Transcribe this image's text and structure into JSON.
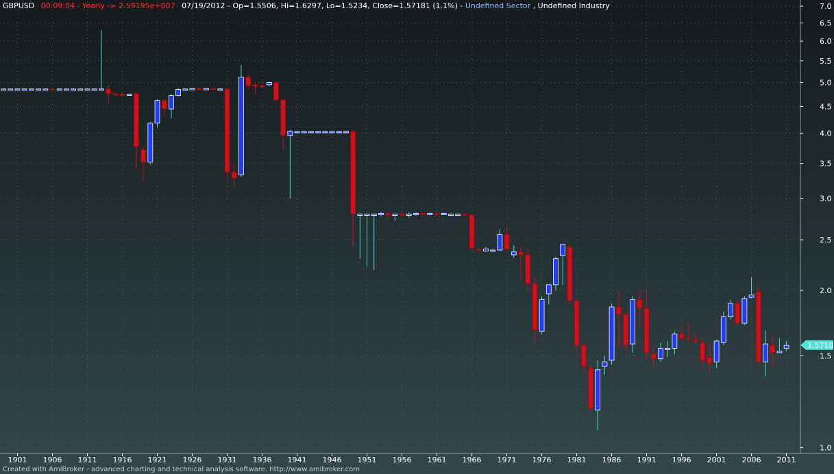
{
  "header": {
    "symbol": "GBPUSD",
    "time_info": "00:09:04 - Yearly -> 2.59195e+007",
    "ohlc": "07/19/2012 - Op=1.5506, Hi=1.6297, Lo=1.5234, Close=1.57181 (1.1%)",
    "separator": " - ",
    "sector": "Undefined Sector",
    "industry": "Undefined Industry"
  },
  "footer": {
    "text": "Created with AmiBroker - advanced charting and technical analysis software. http://www.amibroker.com"
  },
  "colors": {
    "up": "#1f3cff",
    "down": "#d0101a",
    "wick_up": "#4fd8d8",
    "wick_down": "#d0101a",
    "price_badge": "#56e0dc",
    "header_red": "#ff2a2a",
    "header_white": "#ffffff",
    "header_blue": "#8cb4ff"
  },
  "chart_data": {
    "type": "candlestick",
    "y_scale": "log",
    "ylim": [
      0.975,
      7.15
    ],
    "xlim": [
      1898.5,
      2013
    ],
    "y_ticks": [
      7.0,
      6.5,
      6.0,
      5.5,
      5.0,
      4.5,
      4.0,
      3.5,
      3.0,
      2.5,
      2.0,
      1.5,
      1.0
    ],
    "x_ticks": [
      1901,
      1906,
      1911,
      1916,
      1921,
      1926,
      1931,
      1936,
      1941,
      1946,
      1951,
      1956,
      1961,
      1966,
      1971,
      1976,
      1981,
      1986,
      1991,
      1996,
      2001,
      2006,
      2011
    ],
    "last_price": "1.57181",
    "last_value": 1.57181,
    "grid": true,
    "candles": [
      {
        "x": 1899,
        "o": 4.86,
        "h": 4.87,
        "l": 4.85,
        "c": 4.86
      },
      {
        "x": 1900,
        "o": 4.86,
        "h": 4.87,
        "l": 4.85,
        "c": 4.86
      },
      {
        "x": 1901,
        "o": 4.86,
        "h": 4.87,
        "l": 4.85,
        "c": 4.86
      },
      {
        "x": 1902,
        "o": 4.86,
        "h": 4.87,
        "l": 4.85,
        "c": 4.86
      },
      {
        "x": 1903,
        "o": 4.86,
        "h": 4.87,
        "l": 4.85,
        "c": 4.86
      },
      {
        "x": 1904,
        "o": 4.86,
        "h": 4.87,
        "l": 4.85,
        "c": 4.86
      },
      {
        "x": 1905,
        "o": 4.85,
        "h": 4.87,
        "l": 4.84,
        "c": 4.86
      },
      {
        "x": 1906,
        "o": 4.86,
        "h": 4.88,
        "l": 4.84,
        "c": 4.85
      },
      {
        "x": 1907,
        "o": 4.85,
        "h": 4.87,
        "l": 4.84,
        "c": 4.86
      },
      {
        "x": 1908,
        "o": 4.86,
        "h": 4.87,
        "l": 4.85,
        "c": 4.86
      },
      {
        "x": 1909,
        "o": 4.86,
        "h": 4.87,
        "l": 4.85,
        "c": 4.86
      },
      {
        "x": 1910,
        "o": 4.86,
        "h": 4.87,
        "l": 4.85,
        "c": 4.86
      },
      {
        "x": 1911,
        "o": 4.86,
        "h": 4.87,
        "l": 4.85,
        "c": 4.86
      },
      {
        "x": 1912,
        "o": 4.86,
        "h": 4.87,
        "l": 4.85,
        "c": 4.86
      },
      {
        "x": 1913,
        "o": 4.86,
        "h": 6.3,
        "l": 4.85,
        "c": 4.86
      },
      {
        "x": 1914,
        "o": 4.86,
        "h": 4.95,
        "l": 4.55,
        "c": 4.76
      },
      {
        "x": 1915,
        "o": 4.76,
        "h": 4.78,
        "l": 4.72,
        "c": 4.74
      },
      {
        "x": 1916,
        "o": 4.75,
        "h": 4.77,
        "l": 4.72,
        "c": 4.74
      },
      {
        "x": 1917,
        "o": 4.74,
        "h": 4.77,
        "l": 4.72,
        "c": 4.75
      },
      {
        "x": 1918,
        "o": 4.76,
        "h": 4.78,
        "l": 3.42,
        "c": 3.77
      },
      {
        "x": 1919,
        "o": 3.72,
        "h": 3.76,
        "l": 3.23,
        "c": 3.52
      },
      {
        "x": 1920,
        "o": 3.52,
        "h": 4.2,
        "l": 3.48,
        "c": 4.18
      },
      {
        "x": 1921,
        "o": 4.18,
        "h": 4.65,
        "l": 4.1,
        "c": 4.62
      },
      {
        "x": 1922,
        "o": 4.62,
        "h": 4.66,
        "l": 4.3,
        "c": 4.45
      },
      {
        "x": 1923,
        "o": 4.45,
        "h": 4.75,
        "l": 4.27,
        "c": 4.72
      },
      {
        "x": 1924,
        "o": 4.72,
        "h": 4.88,
        "l": 4.7,
        "c": 4.85
      },
      {
        "x": 1925,
        "o": 4.85,
        "h": 4.87,
        "l": 4.83,
        "c": 4.86
      },
      {
        "x": 1926,
        "o": 4.86,
        "h": 4.88,
        "l": 4.84,
        "c": 4.87
      },
      {
        "x": 1927,
        "o": 4.87,
        "h": 4.88,
        "l": 4.84,
        "c": 4.86
      },
      {
        "x": 1928,
        "o": 4.86,
        "h": 4.88,
        "l": 4.84,
        "c": 4.87
      },
      {
        "x": 1929,
        "o": 4.87,
        "h": 4.88,
        "l": 4.84,
        "c": 4.86
      },
      {
        "x": 1930,
        "o": 4.86,
        "h": 4.88,
        "l": 4.84,
        "c": 4.86
      },
      {
        "x": 1931,
        "o": 4.86,
        "h": 4.88,
        "l": 3.25,
        "c": 3.37
      },
      {
        "x": 1932,
        "o": 3.37,
        "h": 3.49,
        "l": 3.15,
        "c": 3.28
      },
      {
        "x": 1933,
        "o": 3.33,
        "h": 5.4,
        "l": 3.3,
        "c": 5.12
      },
      {
        "x": 1934,
        "o": 5.12,
        "h": 5.17,
        "l": 4.85,
        "c": 4.93
      },
      {
        "x": 1935,
        "o": 4.95,
        "h": 5.0,
        "l": 4.75,
        "c": 4.93
      },
      {
        "x": 1936,
        "o": 4.93,
        "h": 5.02,
        "l": 4.88,
        "c": 4.92
      },
      {
        "x": 1937,
        "o": 4.95,
        "h": 5.02,
        "l": 4.92,
        "c": 5.0
      },
      {
        "x": 1938,
        "o": 5.0,
        "h": 5.02,
        "l": 4.62,
        "c": 4.63
      },
      {
        "x": 1939,
        "o": 4.63,
        "h": 4.65,
        "l": 3.72,
        "c": 3.96
      },
      {
        "x": 1940,
        "o": 3.96,
        "h": 4.06,
        "l": 3.0,
        "c": 4.03
      },
      {
        "x": 1941,
        "o": 4.03,
        "h": 4.04,
        "l": 4.02,
        "c": 4.03
      },
      {
        "x": 1942,
        "o": 4.03,
        "h": 4.04,
        "l": 4.02,
        "c": 4.03
      },
      {
        "x": 1943,
        "o": 4.03,
        "h": 4.04,
        "l": 4.02,
        "c": 4.03
      },
      {
        "x": 1944,
        "o": 4.03,
        "h": 4.04,
        "l": 4.02,
        "c": 4.03
      },
      {
        "x": 1945,
        "o": 4.03,
        "h": 4.04,
        "l": 4.02,
        "c": 4.03
      },
      {
        "x": 1946,
        "o": 4.03,
        "h": 4.04,
        "l": 4.02,
        "c": 4.03
      },
      {
        "x": 1947,
        "o": 4.03,
        "h": 4.04,
        "l": 4.02,
        "c": 4.03
      },
      {
        "x": 1948,
        "o": 4.03,
        "h": 4.04,
        "l": 4.02,
        "c": 4.03
      },
      {
        "x": 1949,
        "o": 4.03,
        "h": 4.04,
        "l": 2.42,
        "c": 2.8
      },
      {
        "x": 1950,
        "o": 2.8,
        "h": 2.81,
        "l": 2.3,
        "c": 2.8
      },
      {
        "x": 1951,
        "o": 2.8,
        "h": 2.81,
        "l": 2.22,
        "c": 2.8
      },
      {
        "x": 1952,
        "o": 2.79,
        "h": 2.81,
        "l": 2.19,
        "c": 2.8
      },
      {
        "x": 1953,
        "o": 2.8,
        "h": 2.83,
        "l": 2.77,
        "c": 2.81
      },
      {
        "x": 1954,
        "o": 2.81,
        "h": 2.82,
        "l": 2.74,
        "c": 2.79
      },
      {
        "x": 1955,
        "o": 2.79,
        "h": 2.81,
        "l": 2.72,
        "c": 2.8
      },
      {
        "x": 1956,
        "o": 2.8,
        "h": 2.82,
        "l": 2.77,
        "c": 2.79
      },
      {
        "x": 1957,
        "o": 2.8,
        "h": 2.82,
        "l": 2.76,
        "c": 2.8
      },
      {
        "x": 1958,
        "o": 2.8,
        "h": 2.82,
        "l": 2.78,
        "c": 2.81
      },
      {
        "x": 1959,
        "o": 2.81,
        "h": 2.82,
        "l": 2.79,
        "c": 2.8
      },
      {
        "x": 1960,
        "o": 2.8,
        "h": 2.82,
        "l": 2.79,
        "c": 2.81
      },
      {
        "x": 1961,
        "o": 2.81,
        "h": 2.82,
        "l": 2.78,
        "c": 2.8
      },
      {
        "x": 1962,
        "o": 2.8,
        "h": 2.82,
        "l": 2.79,
        "c": 2.81
      },
      {
        "x": 1963,
        "o": 2.8,
        "h": 2.81,
        "l": 2.79,
        "c": 2.8
      },
      {
        "x": 1964,
        "o": 2.79,
        "h": 2.81,
        "l": 2.78,
        "c": 2.8
      },
      {
        "x": 1965,
        "o": 2.8,
        "h": 2.81,
        "l": 2.78,
        "c": 2.79
      },
      {
        "x": 1966,
        "o": 2.79,
        "h": 2.8,
        "l": 2.39,
        "c": 2.41
      },
      {
        "x": 1967,
        "o": 2.4,
        "h": 2.41,
        "l": 2.38,
        "c": 2.39
      },
      {
        "x": 1968,
        "o": 2.38,
        "h": 2.42,
        "l": 2.37,
        "c": 2.4
      },
      {
        "x": 1969,
        "o": 2.39,
        "h": 2.4,
        "l": 2.38,
        "c": 2.39
      },
      {
        "x": 1970,
        "o": 2.39,
        "h": 2.62,
        "l": 2.38,
        "c": 2.56
      },
      {
        "x": 1971,
        "o": 2.56,
        "h": 2.65,
        "l": 2.39,
        "c": 2.4
      },
      {
        "x": 1972,
        "o": 2.34,
        "h": 2.44,
        "l": 2.31,
        "c": 2.37
      },
      {
        "x": 1973,
        "o": 2.37,
        "h": 2.44,
        "l": 2.1,
        "c": 2.34
      },
      {
        "x": 1974,
        "o": 2.34,
        "h": 2.41,
        "l": 2.0,
        "c": 2.06
      },
      {
        "x": 1975,
        "o": 2.06,
        "h": 2.12,
        "l": 1.57,
        "c": 1.68
      },
      {
        "x": 1976,
        "o": 1.67,
        "h": 1.95,
        "l": 1.65,
        "c": 1.92
      },
      {
        "x": 1977,
        "o": 1.97,
        "h": 2.05,
        "l": 1.88,
        "c": 2.05
      },
      {
        "x": 1978,
        "o": 2.05,
        "h": 2.32,
        "l": 2.0,
        "c": 2.3
      },
      {
        "x": 1979,
        "o": 2.33,
        "h": 2.45,
        "l": 2.05,
        "c": 2.45
      },
      {
        "x": 1980,
        "o": 2.42,
        "h": 2.44,
        "l": 1.88,
        "c": 1.91
      },
      {
        "x": 1981,
        "o": 1.91,
        "h": 1.92,
        "l": 1.52,
        "c": 1.57
      },
      {
        "x": 1982,
        "o": 1.57,
        "h": 1.57,
        "l": 1.4,
        "c": 1.43
      },
      {
        "x": 1983,
        "o": 1.42,
        "h": 1.44,
        "l": 1.17,
        "c": 1.19
      },
      {
        "x": 1984,
        "o": 1.18,
        "h": 1.47,
        "l": 1.08,
        "c": 1.41
      },
      {
        "x": 1985,
        "o": 1.43,
        "h": 1.5,
        "l": 1.38,
        "c": 1.46
      },
      {
        "x": 1986,
        "o": 1.47,
        "h": 1.89,
        "l": 1.44,
        "c": 1.86
      },
      {
        "x": 1987,
        "o": 1.86,
        "h": 1.99,
        "l": 1.55,
        "c": 1.8
      },
      {
        "x": 1988,
        "o": 1.8,
        "h": 1.82,
        "l": 1.53,
        "c": 1.57
      },
      {
        "x": 1989,
        "o": 1.58,
        "h": 1.95,
        "l": 1.52,
        "c": 1.92
      },
      {
        "x": 1990,
        "o": 1.92,
        "h": 2.01,
        "l": 1.7,
        "c": 1.85
      },
      {
        "x": 1991,
        "o": 1.85,
        "h": 2.0,
        "l": 1.47,
        "c": 1.52
      },
      {
        "x": 1992,
        "o": 1.51,
        "h": 1.56,
        "l": 1.42,
        "c": 1.48
      },
      {
        "x": 1993,
        "o": 1.48,
        "h": 1.59,
        "l": 1.46,
        "c": 1.55
      },
      {
        "x": 1994,
        "o": 1.55,
        "h": 1.6,
        "l": 1.49,
        "c": 1.55
      },
      {
        "x": 1995,
        "o": 1.55,
        "h": 1.67,
        "l": 1.51,
        "c": 1.65
      },
      {
        "x": 1996,
        "o": 1.65,
        "h": 1.71,
        "l": 1.61,
        "c": 1.62
      },
      {
        "x": 1997,
        "o": 1.62,
        "h": 1.73,
        "l": 1.59,
        "c": 1.61
      },
      {
        "x": 1998,
        "o": 1.61,
        "h": 1.65,
        "l": 1.58,
        "c": 1.6
      },
      {
        "x": 1999,
        "o": 1.59,
        "h": 1.62,
        "l": 1.42,
        "c": 1.47
      },
      {
        "x": 2000,
        "o": 1.49,
        "h": 1.58,
        "l": 1.39,
        "c": 1.45
      },
      {
        "x": 2001,
        "o": 1.46,
        "h": 1.61,
        "l": 1.42,
        "c": 1.6
      },
      {
        "x": 2002,
        "o": 1.59,
        "h": 1.82,
        "l": 1.57,
        "c": 1.78
      },
      {
        "x": 2003,
        "o": 1.78,
        "h": 1.92,
        "l": 1.76,
        "c": 1.89
      },
      {
        "x": 2004,
        "o": 1.89,
        "h": 1.91,
        "l": 1.71,
        "c": 1.73
      },
      {
        "x": 2005,
        "o": 1.73,
        "h": 1.95,
        "l": 1.72,
        "c": 1.93
      },
      {
        "x": 2006,
        "o": 1.94,
        "h": 2.12,
        "l": 1.93,
        "c": 1.96
      },
      {
        "x": 2007,
        "o": 1.99,
        "h": 2.03,
        "l": 1.44,
        "c": 1.46
      },
      {
        "x": 2008,
        "o": 1.46,
        "h": 1.68,
        "l": 1.37,
        "c": 1.58
      },
      {
        "x": 2009,
        "o": 1.57,
        "h": 1.64,
        "l": 1.43,
        "c": 1.52
      },
      {
        "x": 2010,
        "o": 1.52,
        "h": 1.62,
        "l": 1.52,
        "c": 1.53
      },
      {
        "x": 2011,
        "o": 1.55,
        "h": 1.6,
        "l": 1.53,
        "c": 1.57
      }
    ]
  }
}
